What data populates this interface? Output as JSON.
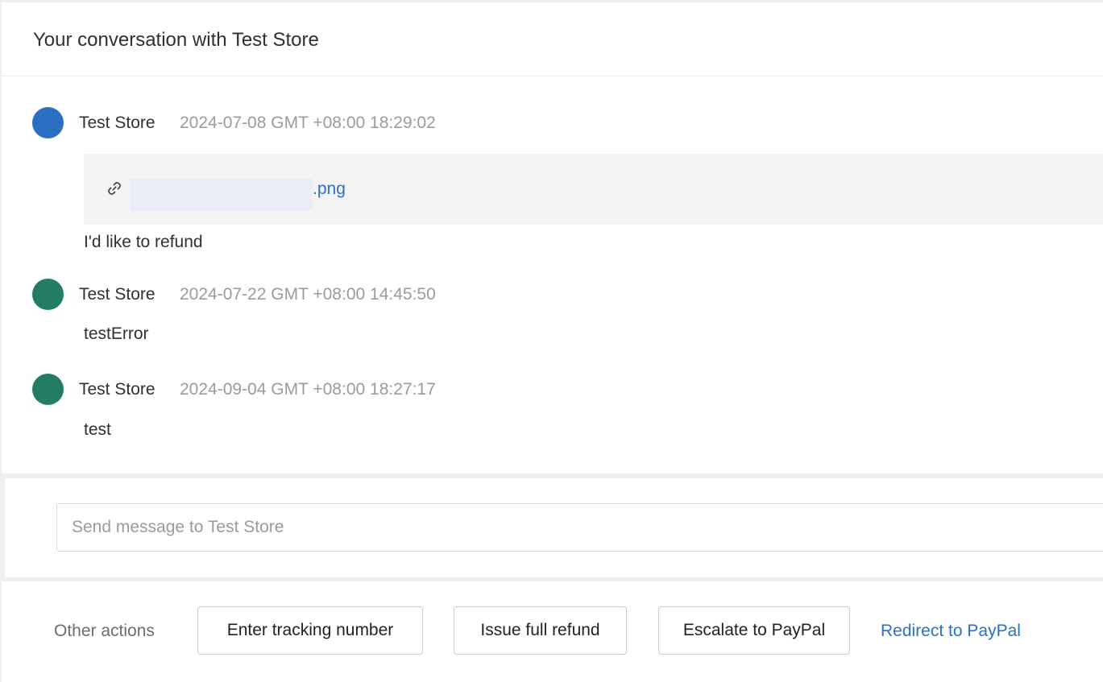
{
  "header": {
    "title": "Your conversation with Test Store"
  },
  "messages": [
    {
      "sender": "Test Store",
      "timestamp": "2024-07-08 GMT +08:00 18:29:02",
      "avatar_color": "#2b6fc2",
      "attachment": {
        "icon": "link-icon",
        "filename_visible": ".png"
      },
      "text": "I'd like to refund"
    },
    {
      "sender": "Test Store",
      "timestamp": "2024-07-22 GMT +08:00 14:45:50",
      "avatar_color": "#237d63",
      "text": "testError"
    },
    {
      "sender": "Test Store",
      "timestamp": "2024-09-04 GMT +08:00 18:27:17",
      "avatar_color": "#237d63",
      "text": "test"
    }
  ],
  "compose": {
    "placeholder": "Send message to Test Store",
    "value": ""
  },
  "actions": {
    "label": "Other actions",
    "enter_tracking": "Enter tracking number",
    "issue_refund": "Issue full refund",
    "escalate": "Escalate to PayPal",
    "redirect_link": "Redirect to PayPal"
  },
  "colors": {
    "link": "#2c6ecb",
    "muted_text": "#9b9b9b",
    "text": "#303030"
  }
}
